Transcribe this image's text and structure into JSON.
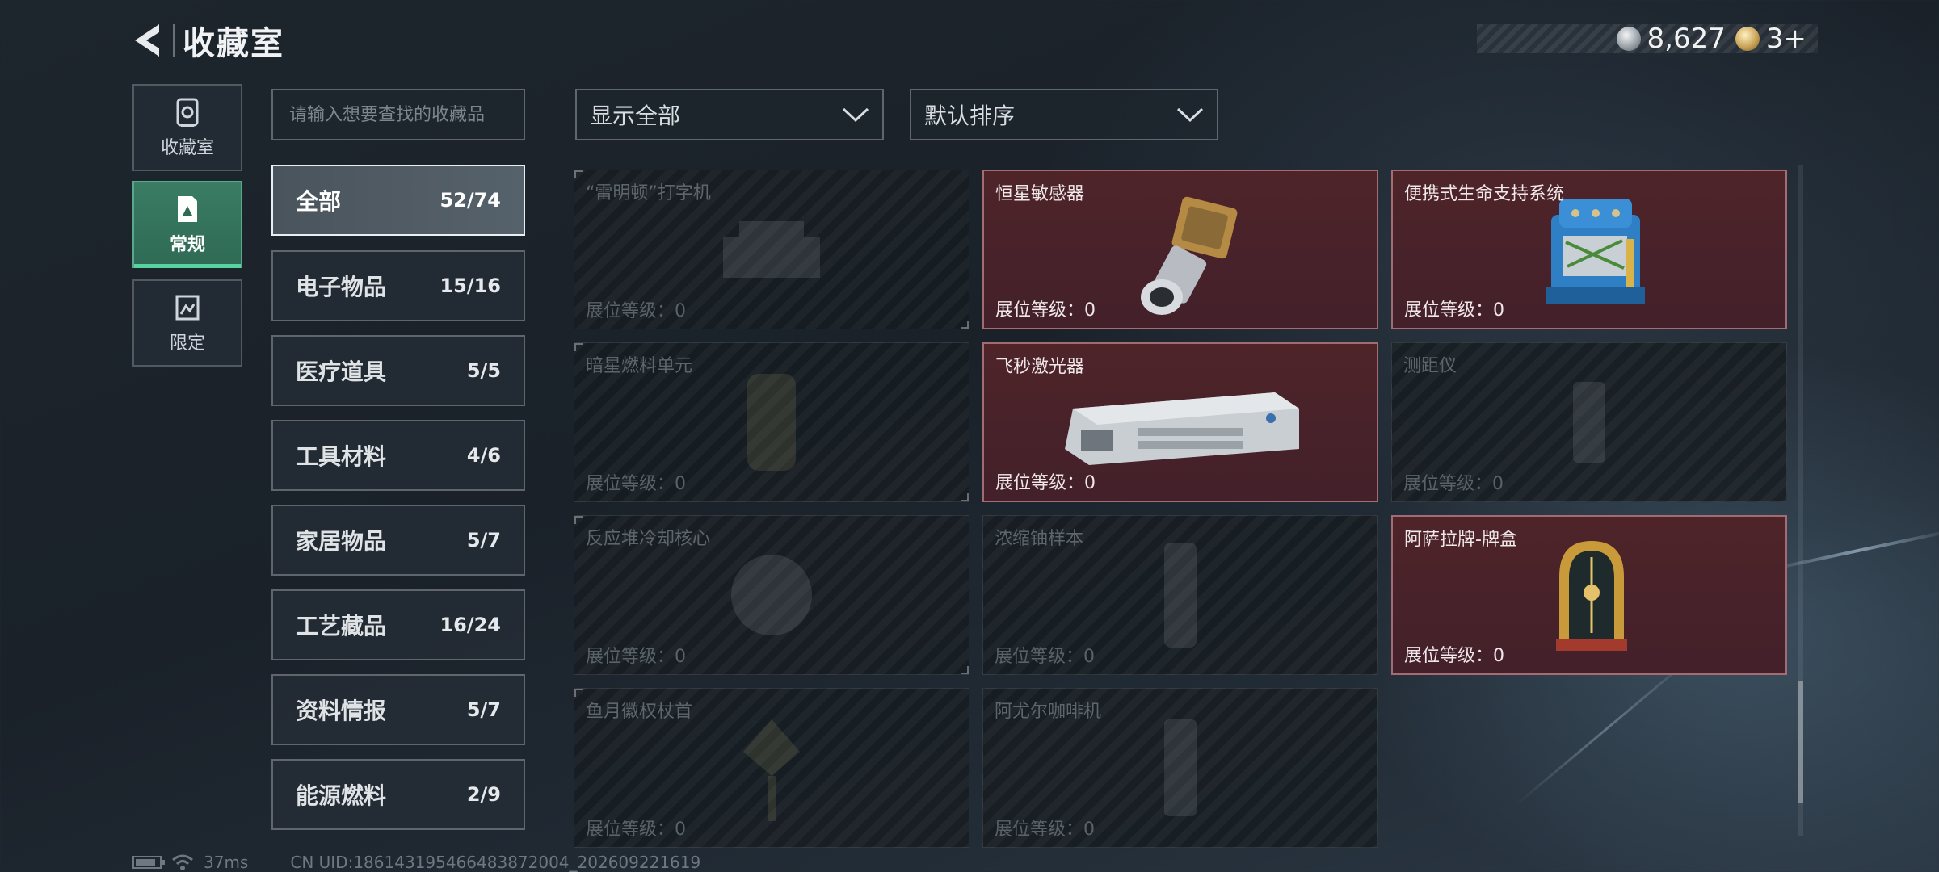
{
  "header": {
    "title": "收藏室"
  },
  "currency": [
    {
      "icon": "silver-coin-icon",
      "value": "8,627"
    },
    {
      "icon": "gold-badge-icon",
      "value": "3+"
    }
  ],
  "side_tabs": [
    {
      "label": "收藏室",
      "icon": "collection-room-icon"
    },
    {
      "label": "常规",
      "icon": "regular-icon",
      "active": true
    },
    {
      "label": "限定",
      "icon": "limited-icon"
    }
  ],
  "search": {
    "placeholder": "请输入想要查找的收藏品"
  },
  "filters": {
    "show": "显示全部",
    "sort": "默认排序"
  },
  "categories": [
    {
      "name": "全部",
      "count": "52/74",
      "active": true
    },
    {
      "name": "电子物品",
      "count": "15/16"
    },
    {
      "name": "医疗道具",
      "count": "5/5"
    },
    {
      "name": "工具材料",
      "count": "4/6"
    },
    {
      "name": "家居物品",
      "count": "5/7"
    },
    {
      "name": "工艺藏品",
      "count": "16/24"
    },
    {
      "name": "资料情报",
      "count": "5/7"
    },
    {
      "name": "能源燃料",
      "count": "2/9"
    }
  ],
  "items": [
    {
      "name": "“雷明顿”打字机",
      "level": "展位等级：0",
      "owned": false
    },
    {
      "name": "恒星敏感器",
      "level": "展位等级：0",
      "owned": true
    },
    {
      "name": "便携式生命支持系统",
      "level": "展位等级：0",
      "owned": true
    },
    {
      "name": "暗星燃料单元",
      "level": "展位等级：0",
      "owned": false
    },
    {
      "name": "飞秒激光器",
      "level": "展位等级：0",
      "owned": true
    },
    {
      "name": "测距仪",
      "level": "展位等级：0",
      "owned": false
    },
    {
      "name": "反应堆冷却核心",
      "level": "展位等级：0",
      "owned": false
    },
    {
      "name": "浓缩铀样本",
      "level": "展位等级：0",
      "owned": false
    },
    {
      "name": "阿萨拉牌-牌盒",
      "level": "展位等级：0",
      "owned": true
    },
    {
      "name": "鱼月徽权杖首",
      "level": "展位等级：0",
      "owned": false
    },
    {
      "name": "阿尤尔咖啡机",
      "level": "展位等级：0",
      "owned": false
    }
  ],
  "status": {
    "ping": "37ms",
    "uid": "CN UID:18614319546648387200​4_202609221619"
  },
  "colors": {
    "accent_green": "#58d3a0",
    "owned_card": "#4e2429"
  }
}
